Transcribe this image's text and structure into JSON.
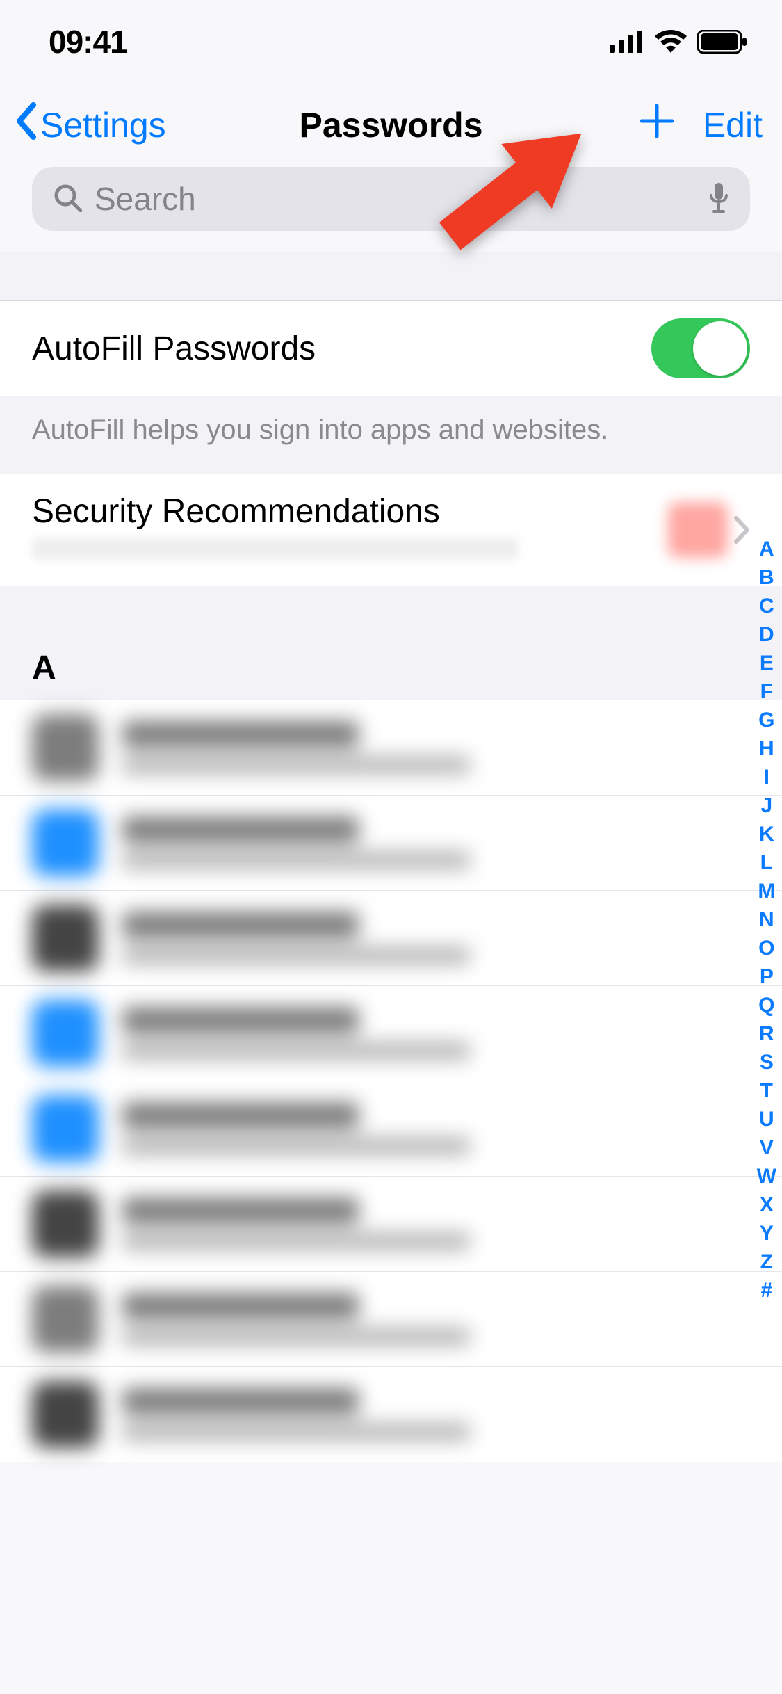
{
  "status": {
    "time": "09:41"
  },
  "nav": {
    "back_label": "Settings",
    "title": "Passwords",
    "edit_label": "Edit"
  },
  "search": {
    "placeholder": "Search"
  },
  "autofill": {
    "label": "AutoFill Passwords",
    "enabled": true,
    "note": "AutoFill helps you sign into apps and websites."
  },
  "security": {
    "title": "Security Recommendations"
  },
  "sections": {
    "letter_header": "A"
  },
  "alpha_index": [
    "A",
    "B",
    "C",
    "D",
    "E",
    "F",
    "G",
    "H",
    "I",
    "J",
    "K",
    "L",
    "M",
    "N",
    "O",
    "P",
    "Q",
    "R",
    "S",
    "T",
    "U",
    "V",
    "W",
    "X",
    "Y",
    "Z",
    "#"
  ],
  "list_items": [
    {
      "tone": "grey"
    },
    {
      "tone": "blue"
    },
    {
      "tone": "dark"
    },
    {
      "tone": "blue"
    },
    {
      "tone": "blue"
    },
    {
      "tone": "dark"
    },
    {
      "tone": "grey"
    },
    {
      "tone": "dark"
    }
  ]
}
